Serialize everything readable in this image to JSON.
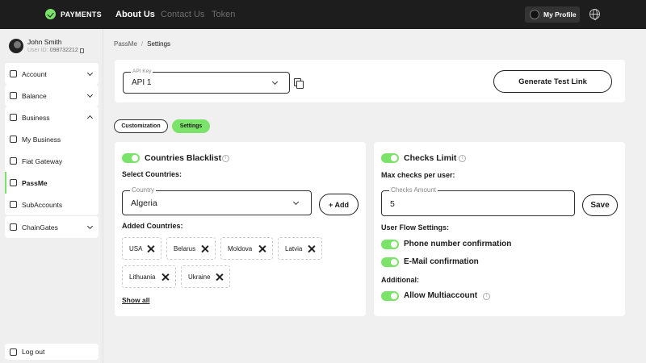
{
  "topbar": {
    "brand": "PAYMENTS",
    "nav": [
      "About Us",
      "Contact Us",
      "Token"
    ],
    "profile_label": "My Profile",
    "globe_icon": "globe-icon",
    "accent_color": "#7ce36a"
  },
  "user": {
    "name": "John Smith",
    "id_label": "User ID:",
    "id_value": "098732212"
  },
  "sidebar": {
    "items": [
      {
        "label": "Account",
        "icon": "grid-icon"
      },
      {
        "label": "Balance",
        "icon": "wallet-icon"
      },
      {
        "label": "Business",
        "icon": "business-icon"
      },
      {
        "label": "My Business",
        "icon": "monitor-icon"
      },
      {
        "label": "Fiat Gateway",
        "icon": "gateway-icon"
      },
      {
        "label": "PassMe",
        "icon": "passme-icon"
      },
      {
        "label": "SubAccounts",
        "icon": "subaccounts-icon"
      },
      {
        "label": "ChainGates",
        "icon": "chaingates-icon"
      }
    ],
    "logout_label": "Log out"
  },
  "breadcrumb": {
    "parent": "PassMe",
    "sep": "/",
    "current": "Settings"
  },
  "api": {
    "legend": "API Key",
    "value": "API 1",
    "generate_label": "Generate Test Link"
  },
  "tabs": {
    "customization": "Customization",
    "settings": "Settings"
  },
  "blacklist": {
    "title": "Countries Blacklist",
    "select_label": "Select Countries:",
    "country_legend": "Country",
    "country_value": "Algeria",
    "add_label": "+ Add",
    "added_label": "Added Countries:",
    "countries": [
      "USA",
      "Belarus",
      "Moldova",
      "Latvia",
      "Lithuania",
      "Ukraine"
    ],
    "show_all": "Show all"
  },
  "checks": {
    "title": "Checks Limit",
    "max_label": "Max checks per user:",
    "amount_legend": "Checks Amount",
    "amount_value": "5",
    "save_label": "Save",
    "flow_label": "User Flow Settings:",
    "phone_label": "Phone number confirmation",
    "email_label": "E-Mail confirmation",
    "additional_label": "Additional:",
    "multi_label": "Allow Multiaccount"
  }
}
